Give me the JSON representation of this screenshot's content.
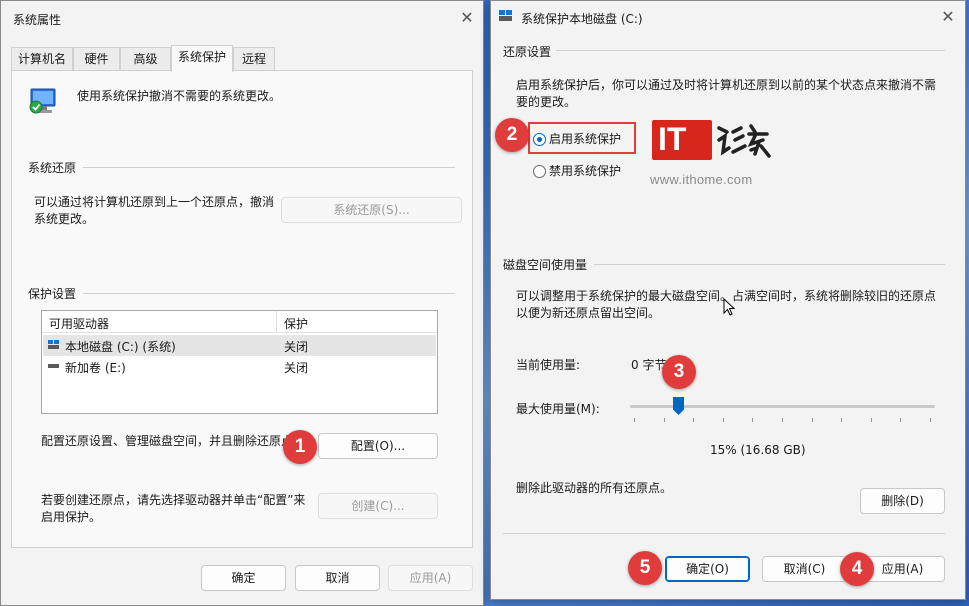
{
  "left_window": {
    "title": "系统属性",
    "tabs": [
      "计算机名",
      "硬件",
      "高级",
      "系统保护",
      "远程"
    ],
    "intro": "使用系统保护撤消不需要的系统更改。",
    "restore_section": "系统还原",
    "restore_desc": "可以通过将计算机还原到上一个还原点，撤消系统更改。",
    "restore_button": "系统还原(S)...",
    "protection_section": "保护设置",
    "list_headers": [
      "可用驱动器",
      "保护"
    ],
    "drives": [
      {
        "name": "本地磁盘 (C:) (系统)",
        "status": "关闭"
      },
      {
        "name": "新加卷 (E:)",
        "status": "关闭"
      }
    ],
    "configure_desc": "配置还原设置、管理磁盘空间，并且删除还原点。",
    "configure_button": "配置(O)...",
    "create_desc": "若要创建还原点，请先选择驱动器并单击“配置”来启用保护。",
    "create_button": "创建(C)...",
    "ok": "确定",
    "cancel": "取消",
    "apply": "应用(A)"
  },
  "right_window": {
    "title": "系统保护本地磁盘 (C:)",
    "restore_section": "还原设置",
    "restore_desc": "启用系统保护后，你可以通过及时将计算机还原到以前的某个状态点来撤消不需要的更改。",
    "enable_option": "启用系统保护",
    "disable_option": "禁用系统保护",
    "selected_option": "enable",
    "disk_section": "磁盘空间使用量",
    "disk_desc": "可以调整用于系统保护的最大磁盘空间。占满空间时，系统将删除较旧的还原点以便为新还原点留出空间。",
    "current_usage_label": "当前使用量:",
    "current_usage_value": "0 字节",
    "max_usage_label": "最大使用量(M):",
    "max_usage_fraction": 0.15,
    "max_usage_value": "15% (16.68 GB)",
    "delete_desc": "删除此驱动器的所有还原点。",
    "delete_button": "删除(D)",
    "ok": "确定(O)",
    "cancel": "取消(C)",
    "apply": "应用(A)"
  },
  "watermark": {
    "logo_text": "IT之家",
    "url": "www.ithome.com"
  },
  "markers": [
    "1",
    "2",
    "3",
    "4",
    "5"
  ],
  "colors": {
    "accent": "#0067c0",
    "marker": "#e03c3c",
    "highlight_box": "#e03c3c"
  }
}
